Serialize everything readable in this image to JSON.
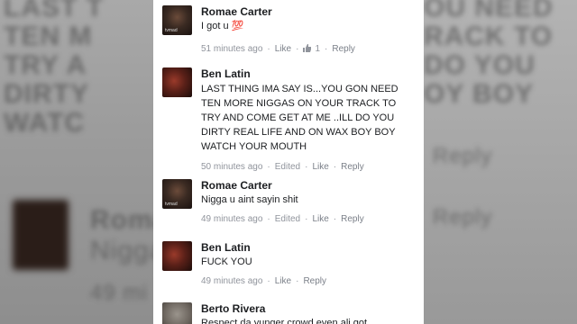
{
  "comments": [
    {
      "author": "Romae Carter",
      "text": "I got u 💯",
      "time": "51 minutes ago",
      "edited": "",
      "like": "Like",
      "reply": "Reply",
      "reactions": "1"
    },
    {
      "author": "Ben Latin",
      "text": "LAST THING IMA SAY IS...YOU GON NEED TEN MORE NIGGAS ON YOUR TRACK TO TRY AND COME GET AT ME ..ILL DO YOU DIRTY REAL LIFE AND ON WAX BOY BOY WATCH YOUR MOUTH",
      "time": "50 minutes ago",
      "edited": "Edited",
      "like": "Like",
      "reply": "Reply"
    },
    {
      "author": "Romae Carter",
      "text": "Nigga u aint sayin shit",
      "time": "49 minutes ago",
      "edited": "Edited",
      "like": "Like",
      "reply": "Reply"
    },
    {
      "author": "Ben Latin",
      "text": "FUCK YOU",
      "time": "49 minutes ago",
      "edited": "",
      "like": "Like",
      "reply": "Reply"
    },
    {
      "author": "Berto Rivera",
      "text": "Respect da yunger crowd even ali got"
    }
  ],
  "backdrop": {
    "left_lines": [
      "LAST T",
      "TEN M",
      "TRY A",
      "DIRTY",
      "WATC",
      "Roma",
      "Nigga",
      "49 mi"
    ],
    "right_lines": [
      "OU NEED",
      "RACK TO",
      "DO YOU",
      "OY BOY",
      "Reply",
      "Reply"
    ]
  },
  "colors": {
    "meta_text": "#90949c",
    "author_text": "#1c1e21",
    "like_blue": "#4267b2"
  }
}
